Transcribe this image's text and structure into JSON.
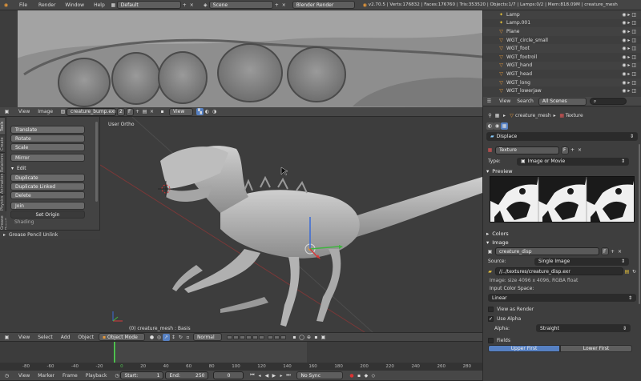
{
  "topbar": {
    "menus": [
      "File",
      "Render",
      "Window",
      "Help"
    ],
    "layout": "Default",
    "scene": "Scene",
    "engine": "Blender Render",
    "stats": "v2.70.5 | Verts:176832 | Faces:176760 | Tris:353520 | Objects:1/7 | Lamps:0/2 | Mem:818.09M | creature_mesh"
  },
  "outliner": {
    "items": [
      "Lamp",
      "Lamp.001",
      "Plane",
      "WGT_circle_small",
      "WGT_foot",
      "WGT_footroll",
      "WGT_hand",
      "WGT_head",
      "WGT_long",
      "WGT_lowerjaw"
    ],
    "menus": [
      "View",
      "Search"
    ],
    "filter": "All Scenes"
  },
  "image_editor": {
    "menus": [
      "View",
      "Image"
    ],
    "image_name": "creature_bump.exr",
    "users": "2",
    "fake": "F",
    "view_label": "View"
  },
  "toolshelf": {
    "tabs": [
      "Tools",
      "Create",
      "Relations",
      "Animation",
      "Physics",
      "Grease Pencil"
    ],
    "transform_buttons": [
      "Translate",
      "Rotate",
      "Scale",
      "Mirror"
    ],
    "edit_header": "Edit",
    "edit_buttons": [
      "Duplicate",
      "Duplicate Linked",
      "Delete"
    ],
    "join": "Join",
    "set_origin": "Set Origin",
    "shading": "Shading",
    "gp_unlink": "Grease Pencil Unlink"
  },
  "viewport": {
    "view_label": "User Ortho",
    "object_label": "(0) creature_mesh : Basis",
    "header_menus": [
      "View",
      "Select",
      "Add",
      "Object"
    ],
    "mode": "Object Mode",
    "orientation": "Normal"
  },
  "timeline": {
    "ruler": [
      "-80",
      "-60",
      "-40",
      "-20",
      "0",
      "20",
      "40",
      "60",
      "80",
      "100",
      "120",
      "140",
      "160",
      "180",
      "200",
      "220",
      "240",
      "260",
      "280"
    ],
    "menus": [
      "View",
      "Marker",
      "Frame",
      "Playback"
    ],
    "start_label": "Start:",
    "start": "1",
    "end_label": "End:",
    "end": "250",
    "current": "0",
    "sync": "No Sync"
  },
  "properties": {
    "breadcrumb": [
      "creature_mesh",
      "Texture"
    ],
    "displace": "Displace",
    "texture_name": "Texture",
    "type_label": "Type:",
    "type": "Image or Movie",
    "preview": "Preview",
    "colors": "Colors",
    "image": "Image",
    "image_name": "creature_disp",
    "source_label": "Source:",
    "source": "Single Image",
    "filepath": "//../textures/creature_disp.exr",
    "image_info": "Image: size 4096 x 4096, RGBA float",
    "input_color_space": "Input Color Space:",
    "color_space": "Linear",
    "view_as_render": "View as Render",
    "use_alpha": "Use Alpha",
    "alpha_label": "Alpha:",
    "alpha": "Straight",
    "fields": "Fields",
    "upper": "Upper First",
    "lower": "Lower First"
  },
  "colors": {
    "accent": "#e8993a",
    "header": "#4a4a4a",
    "viewport": "#3d3d3d",
    "active": "#5680c2"
  }
}
